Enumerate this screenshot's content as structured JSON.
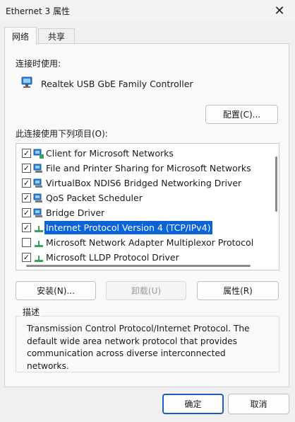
{
  "window": {
    "title": "Ethernet 3 属性",
    "close": "✕"
  },
  "tabs": [
    {
      "label": "网络"
    },
    {
      "label": "共享"
    }
  ],
  "connect_using": {
    "label": "连接时使用:",
    "adapter": "Realtek USB GbE Family Controller",
    "configure_button": "配置(C)..."
  },
  "items_section": {
    "label": "此连接使用下列项目(O):",
    "items": [
      {
        "label": "Client for Microsoft Networks",
        "checked": true,
        "icon": "network-client-icon"
      },
      {
        "label": "File and Printer Sharing for Microsoft Networks",
        "checked": true,
        "icon": "network-service-icon"
      },
      {
        "label": "VirtualBox NDIS6 Bridged Networking Driver",
        "checked": true,
        "icon": "network-service-icon"
      },
      {
        "label": "QoS Packet Scheduler",
        "checked": true,
        "icon": "network-service-icon"
      },
      {
        "label": "Bridge Driver",
        "checked": true,
        "icon": "network-service-icon"
      },
      {
        "label": "Internet Protocol Version 4 (TCP/IPv4)",
        "checked": true,
        "icon": "protocol-icon",
        "selected": true
      },
      {
        "label": "Microsoft Network Adapter Multiplexor Protocol",
        "checked": false,
        "icon": "protocol-icon"
      },
      {
        "label": "Microsoft LLDP Protocol Driver",
        "checked": true,
        "icon": "protocol-icon"
      }
    ]
  },
  "buttons": {
    "install": "安装(N)...",
    "uninstall": "卸载(U)",
    "properties": "属性(R)",
    "ok": "确定",
    "cancel": "取消"
  },
  "description": {
    "legend": "描述",
    "text": "Transmission Control Protocol/Internet Protocol. The default wide area network protocol that provides communication across diverse interconnected networks."
  }
}
